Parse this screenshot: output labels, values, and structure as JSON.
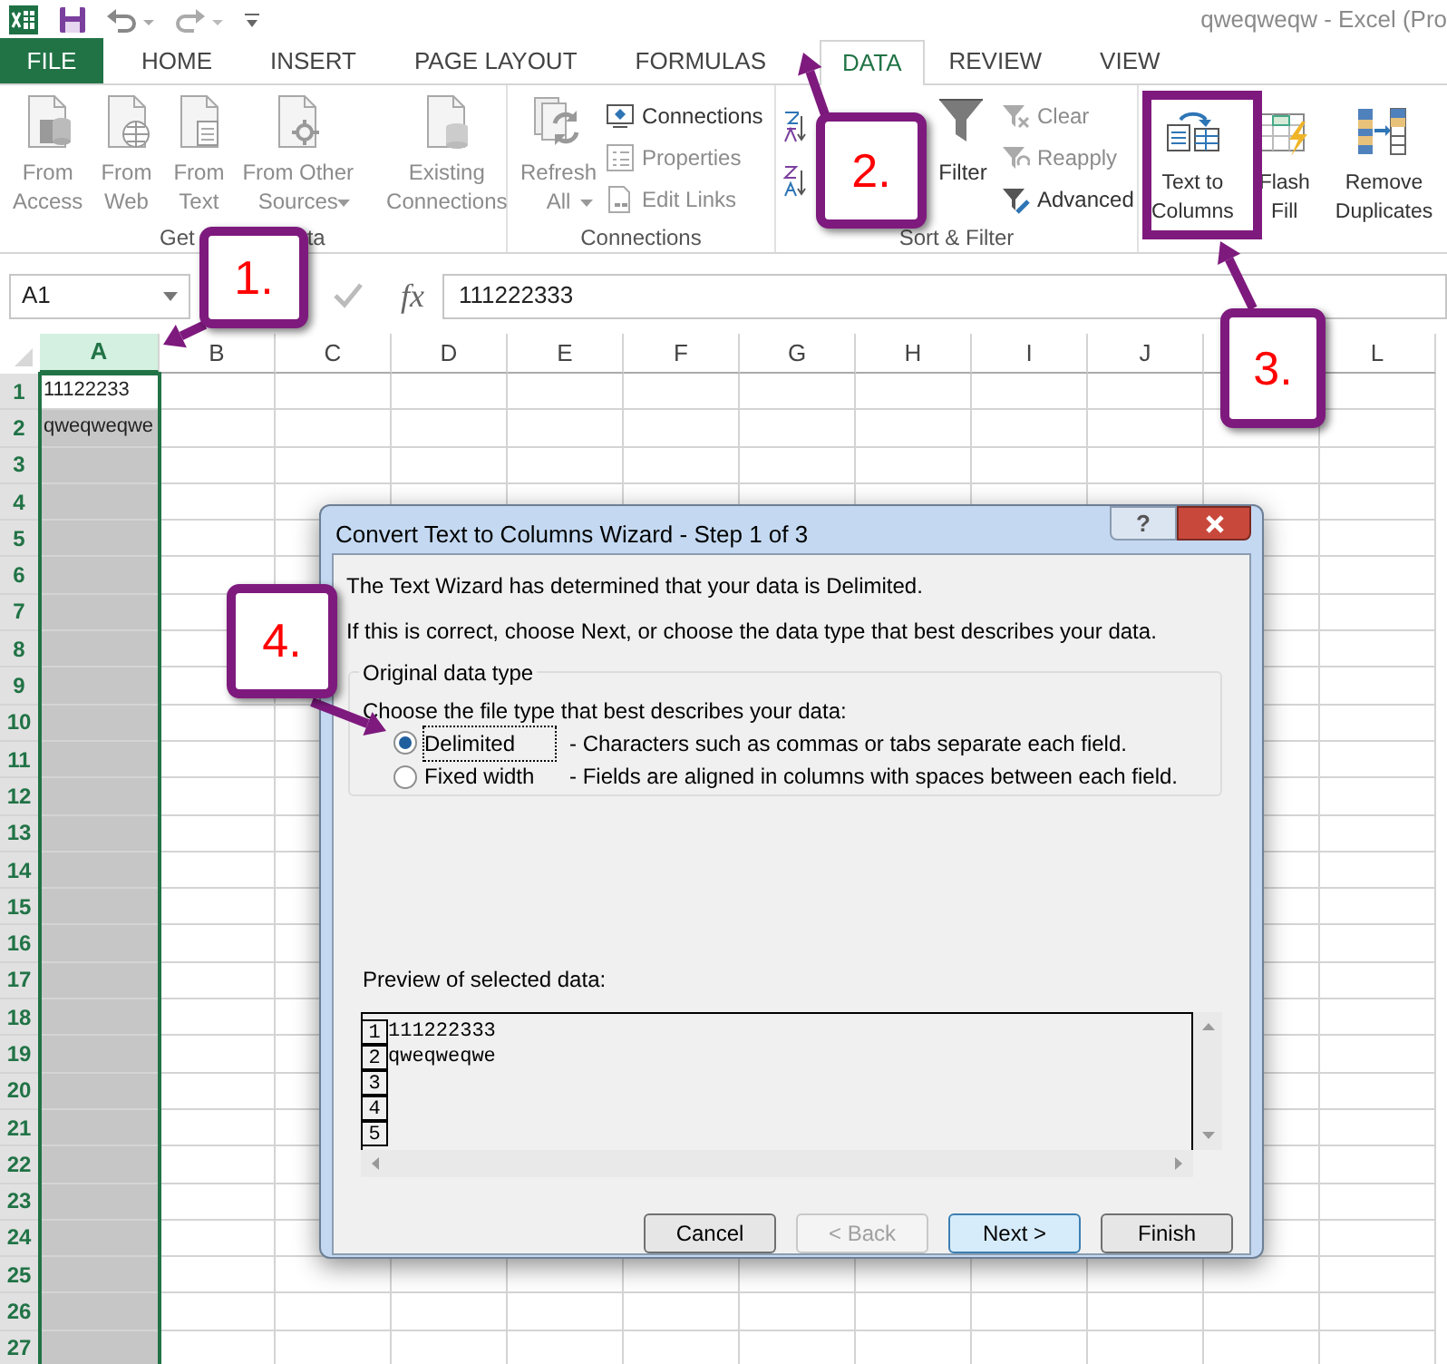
{
  "title_bar": {
    "title": "qweqweqw - Excel (Pro"
  },
  "ribbon_tabs": [
    {
      "label": "FILE",
      "kind": "file",
      "selected": false
    },
    {
      "label": "HOME",
      "kind": "tab",
      "selected": false
    },
    {
      "label": "INSERT",
      "kind": "tab",
      "selected": false
    },
    {
      "label": "PAGE LAYOUT",
      "kind": "tab",
      "selected": false
    },
    {
      "label": "FORMULAS",
      "kind": "tab",
      "selected": false
    },
    {
      "label": "DATA",
      "kind": "tab",
      "selected": true
    },
    {
      "label": "REVIEW",
      "kind": "tab",
      "selected": false
    },
    {
      "label": "VIEW",
      "kind": "tab",
      "selected": false
    }
  ],
  "ribbon_groups": [
    {
      "label_parts": [
        "Get",
        "ta"
      ],
      "items": [
        {
          "kind": "large",
          "label": "From\nAccess",
          "disabled": true
        },
        {
          "kind": "large",
          "label": "From\nWeb",
          "disabled": true
        },
        {
          "kind": "large",
          "label": "From\nText",
          "disabled": true
        },
        {
          "kind": "large",
          "label": "From Other\nSources",
          "disabled": true,
          "dropdown": true
        },
        {
          "kind": "separator"
        },
        {
          "kind": "large",
          "label": "Existing\nConnections",
          "disabled": true
        }
      ]
    },
    {
      "label_parts": [
        "Connections"
      ],
      "items": [
        {
          "kind": "large",
          "label": "Refresh\nAll",
          "disabled": true,
          "dropdown": true
        },
        {
          "kind": "small_stack",
          "buttons": [
            {
              "label": "Connections",
              "disabled": false
            },
            {
              "label": "Properties",
              "disabled": true
            },
            {
              "label": "Edit Links",
              "disabled": true
            }
          ]
        }
      ]
    },
    {
      "label_parts": [
        "Sort & Filter"
      ],
      "items": [
        {
          "kind": "sort_pair"
        },
        {
          "kind": "large",
          "label": "Filter",
          "disabled": false
        },
        {
          "kind": "small_stack",
          "buttons": [
            {
              "label": "Clear",
              "disabled": true
            },
            {
              "label": "Reapply",
              "disabled": true
            },
            {
              "label": "Advanced",
              "disabled": false
            }
          ]
        }
      ]
    },
    {
      "items": [
        {
          "kind": "large",
          "label": "Text to\nColumns",
          "disabled": false
        },
        {
          "kind": "large",
          "label": "Flash\nFill",
          "disabled": false
        },
        {
          "kind": "large",
          "label": "Remove\nDuplicates",
          "disabled": false
        }
      ]
    }
  ],
  "formula_bar": {
    "name_box": "A1",
    "function_label": "fx",
    "formula": "111222333"
  },
  "sheet": {
    "columns": [
      {
        "label": "A",
        "selected": true
      },
      {
        "label": "B",
        "selected": false
      },
      {
        "label": "C",
        "selected": false
      },
      {
        "label": "D",
        "selected": false
      },
      {
        "label": "E",
        "selected": false
      },
      {
        "label": "F",
        "selected": false
      },
      {
        "label": "G",
        "selected": false
      },
      {
        "label": "H",
        "selected": false
      },
      {
        "label": "I",
        "selected": false
      },
      {
        "label": "J",
        "selected": false
      },
      {
        "selected": false
      },
      {
        "label": "L",
        "selected": false
      }
    ],
    "rows": [
      {
        "number": "1",
        "a": "11122233",
        "selected": true
      },
      {
        "number": "2",
        "a": "qweqweqwe",
        "selected": true
      },
      {
        "number": "3",
        "selected": true
      },
      {
        "number": "4",
        "selected": true
      },
      {
        "number": "5",
        "selected": true
      },
      {
        "number": "6",
        "selected": true
      },
      {
        "number": "7",
        "selected": true
      },
      {
        "number": "8",
        "selected": true
      },
      {
        "number": "9",
        "selected": true
      },
      {
        "number": "10",
        "selected": true
      },
      {
        "number": "11",
        "selected": true
      },
      {
        "number": "12",
        "selected": true
      },
      {
        "number": "13",
        "selected": true
      },
      {
        "number": "14",
        "selected": true
      },
      {
        "number": "15",
        "selected": true
      },
      {
        "number": "16",
        "selected": true
      },
      {
        "number": "17",
        "selected": true
      },
      {
        "number": "18",
        "selected": true
      },
      {
        "number": "19",
        "selected": true
      },
      {
        "number": "20",
        "selected": true
      },
      {
        "number": "21",
        "selected": true
      },
      {
        "number": "22",
        "selected": true
      },
      {
        "number": "23",
        "selected": true
      },
      {
        "number": "24",
        "selected": true
      },
      {
        "number": "25",
        "selected": true
      },
      {
        "number": "26",
        "selected": true
      },
      {
        "number": "27",
        "selected": true
      }
    ]
  },
  "dialog": {
    "title": "Convert Text to Columns Wizard - Step 1 of 3",
    "help_button": "?",
    "intro": [
      "The Text Wizard has determined that your data is Delimited.",
      "If this is correct, choose Next, or choose the data type that best describes your data."
    ],
    "group_title": "Original data type",
    "prompt": "Choose the file type that best describes your data:",
    "options": [
      {
        "label": "Delimited",
        "description": "- Characters such as commas or tabs separate each field.",
        "selected": true
      },
      {
        "label": "Fixed width",
        "description": "- Fields are aligned in columns with spaces between each field.",
        "selected": false
      }
    ],
    "preview_label": "Preview of selected data:",
    "preview_rows": [
      {
        "number": "1",
        "text": "111222333"
      },
      {
        "number": "2",
        "text": "qweqweqwe"
      },
      {
        "number": "3"
      },
      {
        "number": "4"
      },
      {
        "number": "5"
      }
    ],
    "buttons": [
      {
        "label": "Cancel",
        "kind": "normal",
        "disabled": false
      },
      {
        "label": "< Back",
        "kind": "normal",
        "disabled": true
      },
      {
        "label": "Next >",
        "kind": "default",
        "disabled": false
      },
      {
        "label": "Finish",
        "kind": "normal",
        "disabled": false
      }
    ]
  },
  "callouts": [
    {
      "label": "1."
    },
    {
      "label": "2."
    },
    {
      "label": "3."
    },
    {
      "label": "4."
    }
  ]
}
